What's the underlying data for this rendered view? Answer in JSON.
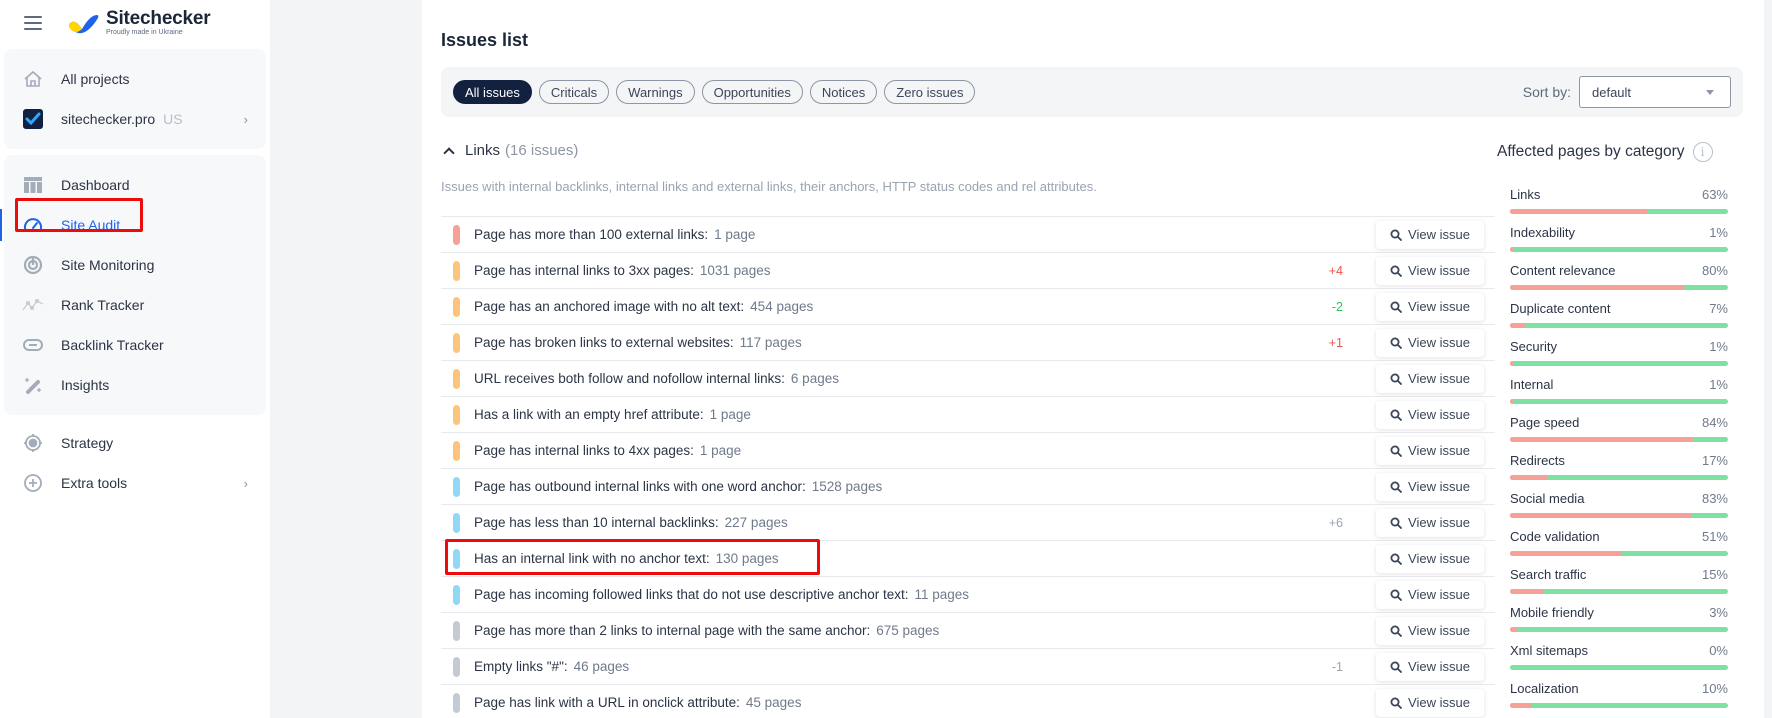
{
  "brand": {
    "name": "Sitechecker",
    "tagline": "Proudly made in Ukraine"
  },
  "sidebar": {
    "top_items": [
      {
        "label": "All projects",
        "icon": "home-icon"
      },
      {
        "label": "sitechecker.pro",
        "sub": "US",
        "icon": "project-logo-icon"
      }
    ],
    "items": [
      {
        "label": "Dashboard",
        "icon": "dashboard-icon"
      },
      {
        "label": "Site Audit",
        "icon": "speedometer-icon",
        "active": true
      },
      {
        "label": "Site Monitoring",
        "icon": "monitoring-icon"
      },
      {
        "label": "Rank Tracker",
        "icon": "rank-chart-icon"
      },
      {
        "label": "Backlink Tracker",
        "icon": "link-icon"
      },
      {
        "label": "Insights",
        "icon": "magic-wand-icon"
      }
    ],
    "lower_items": [
      {
        "label": "Strategy",
        "icon": "target-icon"
      },
      {
        "label": "Extra tools",
        "icon": "plus-circle-icon"
      }
    ]
  },
  "main": {
    "title": "Issues list",
    "filters": [
      "All issues",
      "Criticals",
      "Warnings",
      "Opportunities",
      "Notices",
      "Zero issues"
    ],
    "active_filter": "All issues",
    "sort_label": "Sort by:",
    "sort_value": "default",
    "section": {
      "name": "Links",
      "count": "(16 issues)",
      "description": "Issues with internal backlinks, internal links and external links, their anchors, HTTP status codes and rel attributes."
    },
    "view_label": "View issue",
    "severity_colors": {
      "critical": "#f6a198",
      "warning": "#fdc57b",
      "opportunity": "#91d8f7",
      "notice": "#c5cbd5"
    },
    "delta_colors": {
      "up": "#f0534a",
      "down": "#2fbf5e",
      "neutral": "#9aa3b1"
    },
    "issues": [
      {
        "text": "Page has more than 100 external links:",
        "pages": "1 page",
        "severity": "critical",
        "delta": "",
        "delta_type": ""
      },
      {
        "text": "Page has internal links to 3xx pages:",
        "pages": "1031 pages",
        "severity": "warning",
        "delta": "+4",
        "delta_type": "up"
      },
      {
        "text": "Page has an anchored image with no alt text:",
        "pages": "454 pages",
        "severity": "warning",
        "delta": "-2",
        "delta_type": "down"
      },
      {
        "text": "Page has broken links to external websites:",
        "pages": "117 pages",
        "severity": "warning",
        "delta": "+1",
        "delta_type": "up"
      },
      {
        "text": "URL receives both follow and nofollow internal links:",
        "pages": "6 pages",
        "severity": "warning",
        "delta": "",
        "delta_type": ""
      },
      {
        "text": "Has a link with an empty href attribute:",
        "pages": "1 page",
        "severity": "warning",
        "delta": "",
        "delta_type": ""
      },
      {
        "text": "Page has internal links to 4xx pages:",
        "pages": "1 page",
        "severity": "warning",
        "delta": "",
        "delta_type": ""
      },
      {
        "text": "Page has outbound internal links with one word anchor:",
        "pages": "1528 pages",
        "severity": "opportunity",
        "delta": "",
        "delta_type": ""
      },
      {
        "text": "Page has less than 10 internal backlinks:",
        "pages": "227 pages",
        "severity": "opportunity",
        "delta": "+6",
        "delta_type": "neutral"
      },
      {
        "text": "Has an internal link with no anchor text:",
        "pages": "130 pages",
        "severity": "opportunity",
        "delta": "",
        "delta_type": "",
        "highlighted": true
      },
      {
        "text": "Page has incoming followed links that do not use descriptive anchor text:",
        "pages": "11 pages",
        "severity": "opportunity",
        "delta": "",
        "delta_type": ""
      },
      {
        "text": "Page has more than 2 links to internal page with the same anchor:",
        "pages": "675 pages",
        "severity": "notice",
        "delta": "",
        "delta_type": ""
      },
      {
        "text": "Empty links \"#\":",
        "pages": "46 pages",
        "severity": "notice",
        "delta": "-1",
        "delta_type": "neutral"
      },
      {
        "text": "Page has link with a URL in onclick attribute:",
        "pages": "45 pages",
        "severity": "notice",
        "delta": "",
        "delta_type": ""
      }
    ]
  },
  "categories": {
    "title": "Affected pages by category",
    "items": [
      {
        "name": "Links",
        "percent": 63
      },
      {
        "name": "Indexability",
        "percent": 1
      },
      {
        "name": "Content relevance",
        "percent": 80
      },
      {
        "name": "Duplicate content",
        "percent": 7
      },
      {
        "name": "Security",
        "percent": 1
      },
      {
        "name": "Internal",
        "percent": 1
      },
      {
        "name": "Page speed",
        "percent": 84
      },
      {
        "name": "Redirects",
        "percent": 17
      },
      {
        "name": "Social media",
        "percent": 83
      },
      {
        "name": "Code validation",
        "percent": 51
      },
      {
        "name": "Search traffic",
        "percent": 15
      },
      {
        "name": "Mobile friendly",
        "percent": 3
      },
      {
        "name": "Xml sitemaps",
        "percent": 0
      },
      {
        "name": "Localization",
        "percent": 10
      }
    ]
  }
}
